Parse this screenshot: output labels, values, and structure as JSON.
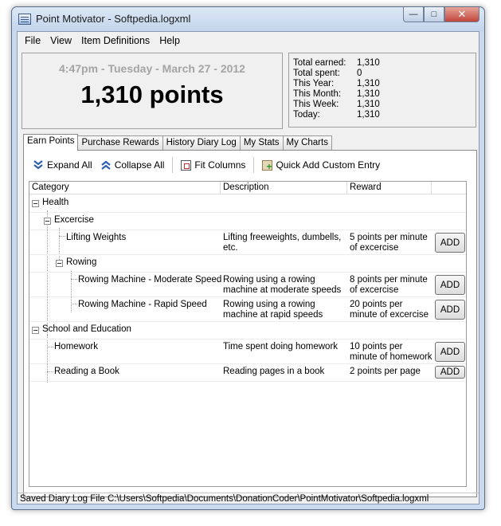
{
  "window": {
    "title": "Point Motivator - Softpedia.logxml"
  },
  "menu": [
    "File",
    "View",
    "Item Definitions",
    "Help"
  ],
  "summary": {
    "datetime": "4:47pm - Tuesday - March 27 - 2012",
    "points": "1,310 points"
  },
  "stats": [
    {
      "label": "Total earned:",
      "value": "1,310"
    },
    {
      "label": "Total spent:",
      "value": "0"
    },
    {
      "label": "This Year:",
      "value": "1,310"
    },
    {
      "label": "This Month:",
      "value": "1,310"
    },
    {
      "label": "This Week:",
      "value": "1,310"
    },
    {
      "label": "Today:",
      "value": "1,310"
    }
  ],
  "tabs": [
    "Earn Points",
    "Purchase Rewards",
    "History Diary Log",
    "My Stats",
    "My Charts"
  ],
  "toolbar": {
    "expand_all": "Expand All",
    "collapse_all": "Collapse All",
    "fit_columns": "Fit Columns",
    "quick_add": "Quick Add Custom Entry"
  },
  "columns": {
    "category": "Category",
    "description": "Description",
    "reward": "Reward"
  },
  "rows": [
    {
      "category": "Health"
    },
    {
      "category": "Excercise"
    },
    {
      "category": "Lifting Weights",
      "description": "Lifting freeweights, dumbells, etc.",
      "reward": "5 points per minute of excercise",
      "button": "ADD"
    },
    {
      "category": "Rowing"
    },
    {
      "category": "Rowing Machine - Moderate Speed",
      "description": "Rowing using a rowing machine at moderate speeds",
      "reward": "8 points per minute of excercise",
      "button": "ADD"
    },
    {
      "category": "Rowing Machine - Rapid Speed",
      "description": "Rowing using a rowing machine at rapid speeds",
      "reward": "20 points per minute of excercise",
      "button": "ADD"
    },
    {
      "category": "School and Education"
    },
    {
      "category": "Homework",
      "description": "Time spent doing homework",
      "reward": "10 points per minute of homework",
      "button": "ADD"
    },
    {
      "category": "Reading a Book",
      "description": "Reading pages in a book",
      "reward": "2 points per page",
      "button": "ADD"
    }
  ],
  "status": "Saved Diary Log File C:\\Users\\Softpedia\\Documents\\DonationCoder\\PointMotivator\\Softpedia.logxml",
  "colors": {
    "titlebar": "#c9daee",
    "close_button": "#c0453a",
    "chevron_blue": "#2f5fb4",
    "date_text": "#a4a4a4"
  }
}
